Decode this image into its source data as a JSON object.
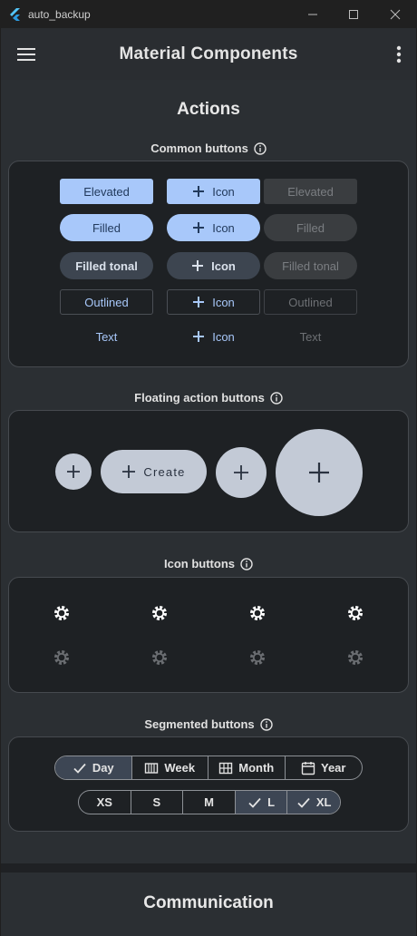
{
  "window": {
    "title": "auto_backup"
  },
  "appbar": {
    "title": "Material Components",
    "menu_icon": "menu-icon",
    "more_icon": "more-vert-icon"
  },
  "actions": {
    "title": "Actions",
    "common": {
      "title": "Common buttons",
      "elevated": "Elevated",
      "filled": "Filled",
      "filled_tonal": "Filled tonal",
      "outlined": "Outlined",
      "text": "Text",
      "icon": "Icon"
    },
    "fab": {
      "title": "Floating action buttons",
      "create": "Create"
    },
    "icon_buttons": {
      "title": "Icon buttons",
      "icon": "settings-icon"
    },
    "segmented": {
      "title": "Segmented buttons",
      "row1": [
        "Day",
        "Week",
        "Month",
        "Year"
      ],
      "row1_selected": "Day",
      "row2": [
        "XS",
        "S",
        "M",
        "L",
        "XL"
      ],
      "row2_selected": [
        "L",
        "XL"
      ]
    }
  },
  "communication": {
    "title": "Communication"
  },
  "colors": {
    "primary": "#a8c8fa",
    "surface": "#2b2f33",
    "card": "#1e2124"
  }
}
